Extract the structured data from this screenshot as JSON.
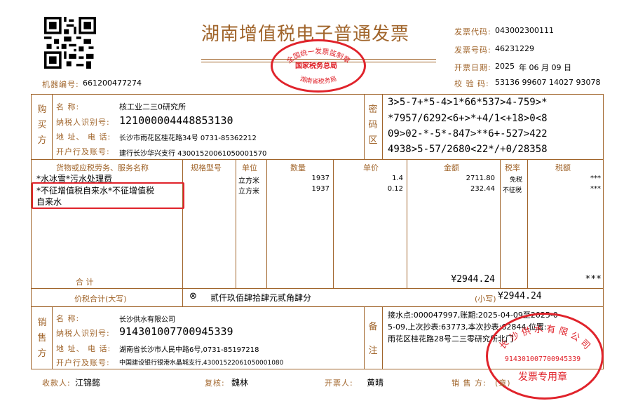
{
  "header": {
    "title": "湖南增值税电子普通发票",
    "machine_no_label": "机器编号:",
    "machine_no": "661200477274",
    "invoice_code_label": "发票代码:",
    "invoice_code": "043002300111",
    "invoice_no_label": "发票号码:",
    "invoice_no": "46231229",
    "date_label": "开票日期:",
    "date_year": "2025",
    "date_mid": "年 06 月 09 日",
    "checksum_label": "校    验 码:",
    "checksum": "53136 99607 14027 93078"
  },
  "tax_seal": {
    "top": "全国统一发票监制章",
    "middle": "国家税务总局",
    "bottom": "湖南省税务局"
  },
  "buyer": {
    "section_label": "购买方",
    "name_label": "名    称:",
    "name": "核工业二三0研究所",
    "taxid_label": "纳税人识别号:",
    "taxid": "121000004448853130",
    "addr_label": "地 址、 电 话:",
    "addr": "长沙市雨花区桂花路34号 0731-85362212",
    "bank_label": "开户行及账号:",
    "bank": "建行长沙华兴支行 43001520061050001570"
  },
  "cipher": {
    "section_label": "密码区",
    "lines": [
      "3>5-7+*5-4>1*66*537>4-759>*",
      "*7957/6292<6+>*+4/1<+18>0<8",
      "09>02-*-5*-847>**6+-527>422",
      "4938>5-57/2680<22*/+0/28358"
    ]
  },
  "items_header": {
    "name": "货物或应税劳务、服务名称",
    "spec": "规格型号",
    "unit": "单位",
    "qty": "数量",
    "price": "单价",
    "amount": "金额",
    "rate": "税率",
    "tax": "税额"
  },
  "items": [
    {
      "name": "*水冰雪*污水处理费",
      "unit": "立方米",
      "qty": "1937",
      "price": "1.4",
      "amount": "2711.80",
      "rate": "免税",
      "tax": "***"
    },
    {
      "name": "*不征增值税自来水*不征增值税",
      "name2": "自来水",
      "unit": "立方米",
      "qty": "1937",
      "price": "0.12",
      "amount": "232.44",
      "rate": "不征税",
      "tax": "***"
    }
  ],
  "totals": {
    "sum_label": "合    计",
    "sum_amount": "¥2944.24",
    "sum_tax": "***",
    "total_label": "价税合计(大写)",
    "total_words": "贰仟玖佰肆拾肆元贰角肆分",
    "total_small_label": "(小写)",
    "total_small": "¥2944.24"
  },
  "seller": {
    "section_label": "销售方",
    "name_label": "名    称:",
    "name": "长沙供水有限公司",
    "taxid_label": "纳税人识别号:",
    "taxid": "914301007700945339",
    "addr_label": "地 址、 电 话:",
    "addr": "湖南省长沙市人民中路6号,0731-85197218",
    "bank_label": "开户行及账号:",
    "bank": "中国建设银行银港水晶城支行,43001522061050001080"
  },
  "remarks": {
    "section_label": "备注",
    "line1": "接水点:000047997,账期:2025-04-09至2025-0",
    "line2": "5-09,上次抄表:63773,本次抄表:62844,位置:",
    "line3": "雨花区桂花路28号二三零研究所北门"
  },
  "seller_seal": {
    "top": "长 沙 供 水 有 限 公 司",
    "taxid": "914301007700945339",
    "bottom": "发票专用章"
  },
  "footer": {
    "payee_label": "收款人:",
    "payee": "江锦懿",
    "reviewer_label": "复核:",
    "reviewer": "魏林",
    "issuer_label": "开票人:",
    "issuer": "黄晴",
    "seller_label": "销 售 方:",
    "seller_mark": "(章)"
  },
  "colors": {
    "frame": "#a0642a",
    "seal": "#e0232b",
    "highlight": "#e0232b"
  }
}
